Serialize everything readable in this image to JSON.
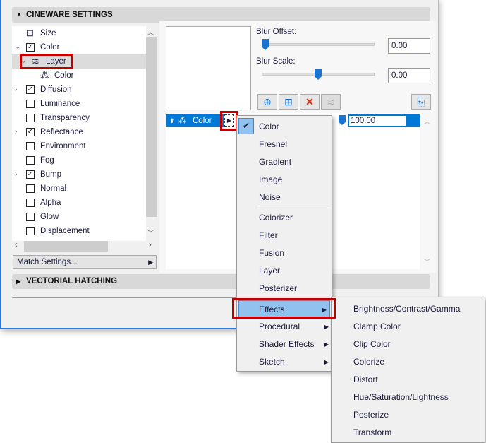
{
  "sections": {
    "cineware": "CINEWARE SETTINGS",
    "hatching": "VECTORIAL HATCHING"
  },
  "tree": [
    {
      "label": "Size",
      "icon": "size-icon",
      "checkbox": null,
      "expander": null
    },
    {
      "label": "Color",
      "checkbox": true,
      "expander": "expanded"
    },
    {
      "label": "Layer",
      "icon": "layers-icon",
      "checkbox": null,
      "expander": "expanded",
      "selected": true
    },
    {
      "label": "Color",
      "icon": "color-shader-icon",
      "checkbox": null,
      "expander": null
    },
    {
      "label": "Diffusion",
      "checkbox": true,
      "expander": "collapsed"
    },
    {
      "label": "Luminance",
      "checkbox": false
    },
    {
      "label": "Transparency",
      "checkbox": false
    },
    {
      "label": "Reflectance",
      "checkbox": true,
      "expander": "collapsed"
    },
    {
      "label": "Environment",
      "checkbox": false
    },
    {
      "label": "Fog",
      "checkbox": false
    },
    {
      "label": "Bump",
      "checkbox": true,
      "expander": "collapsed"
    },
    {
      "label": "Normal",
      "checkbox": false
    },
    {
      "label": "Alpha",
      "checkbox": false
    },
    {
      "label": "Glow",
      "checkbox": false
    },
    {
      "label": "Displacement",
      "checkbox": false
    }
  ],
  "match_settings": "Match Settings...",
  "blur_offset": {
    "label": "Blur Offset:",
    "value": "0.00",
    "slider": 0
  },
  "blur_scale": {
    "label": "Blur Scale:",
    "value": "0.00",
    "slider": 0.5
  },
  "layer_row": {
    "label": "Color",
    "value": "100.00"
  },
  "menu": {
    "items": [
      "Color",
      "Fresnel",
      "Gradient",
      "Image",
      "Noise",
      "Colorizer",
      "Filter",
      "Fusion",
      "Layer",
      "Posterizer",
      "Effects",
      "Procedural",
      "Shader Effects",
      "Sketch"
    ],
    "checked": "Color",
    "highlighted": "Effects"
  },
  "submenu": [
    "Brightness/Contrast/Gamma",
    "Clamp Color",
    "Clip Color",
    "Colorize",
    "Distort",
    "Hue/Saturation/Lightness",
    "Posterize",
    "Transform"
  ],
  "colors": {
    "accent": "#0078d7",
    "highlight": "#91c1ee",
    "callout": "#c00000"
  }
}
